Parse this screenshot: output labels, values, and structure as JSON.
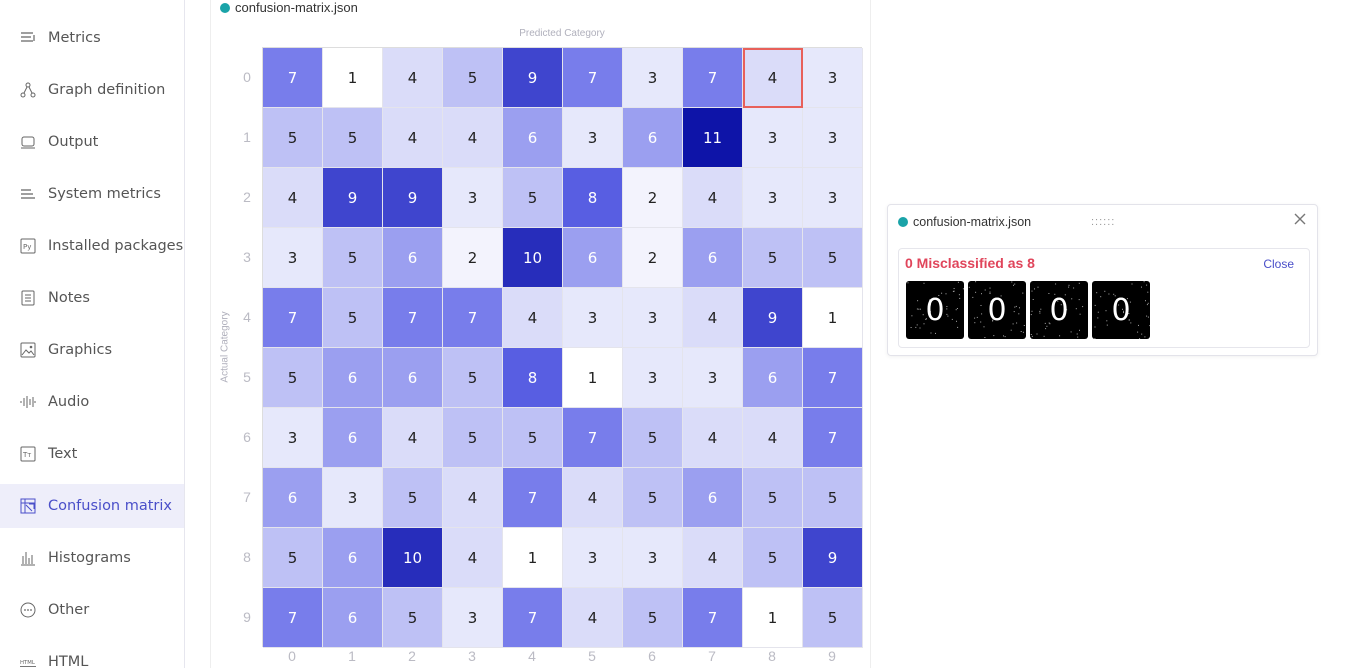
{
  "sidebar": {
    "items": [
      {
        "label": "Metrics",
        "icon": "metrics-icon"
      },
      {
        "label": "Graph definition",
        "icon": "graph-icon"
      },
      {
        "label": "Output",
        "icon": "output-icon"
      },
      {
        "label": "System metrics",
        "icon": "system-metrics-icon"
      },
      {
        "label": "Installed packages",
        "icon": "python-icon"
      },
      {
        "label": "Notes",
        "icon": "notes-icon"
      },
      {
        "label": "Graphics",
        "icon": "image-icon"
      },
      {
        "label": "Audio",
        "icon": "audio-icon"
      },
      {
        "label": "Text",
        "icon": "text-icon"
      },
      {
        "label": "Confusion matrix",
        "icon": "confusion-matrix-icon",
        "active": true
      },
      {
        "label": "Histograms",
        "icon": "histogram-icon"
      },
      {
        "label": "Other",
        "icon": "other-icon"
      },
      {
        "label": "HTML",
        "icon": "html-icon"
      }
    ]
  },
  "main": {
    "file_name": "confusion-matrix.json",
    "predicted_label": "Predicted Category",
    "actual_label": "Actual Category"
  },
  "chart_data": {
    "type": "heatmap",
    "title": "",
    "xlabel": "Predicted Category",
    "ylabel": "Actual Category",
    "x_categories": [
      "0",
      "1",
      "2",
      "3",
      "4",
      "5",
      "6",
      "7",
      "8",
      "9"
    ],
    "y_categories": [
      "0",
      "1",
      "2",
      "3",
      "4",
      "5",
      "6",
      "7",
      "8",
      "9"
    ],
    "values": [
      [
        7,
        1,
        4,
        5,
        9,
        7,
        3,
        7,
        4,
        3
      ],
      [
        5,
        5,
        4,
        4,
        6,
        3,
        6,
        11,
        3,
        3
      ],
      [
        4,
        9,
        9,
        3,
        5,
        8,
        2,
        4,
        3,
        3
      ],
      [
        3,
        5,
        6,
        2,
        10,
        6,
        2,
        6,
        5,
        5
      ],
      [
        7,
        5,
        7,
        7,
        4,
        3,
        3,
        4,
        9,
        1
      ],
      [
        5,
        6,
        6,
        5,
        8,
        1,
        3,
        3,
        6,
        7
      ],
      [
        3,
        6,
        4,
        5,
        5,
        7,
        5,
        4,
        4,
        7
      ],
      [
        6,
        3,
        5,
        4,
        7,
        4,
        5,
        6,
        5,
        5
      ],
      [
        5,
        6,
        10,
        4,
        1,
        3,
        3,
        4,
        5,
        9
      ],
      [
        7,
        6,
        5,
        3,
        7,
        4,
        5,
        7,
        1,
        5
      ]
    ],
    "selected_cell": {
      "row": 0,
      "col": 8
    }
  },
  "popup": {
    "file_name": "confusion-matrix.json",
    "drag_handle": "::::::",
    "title": "0 Misclassified as 8",
    "close_label": "Close",
    "images": [
      "0",
      "0",
      "0",
      "0"
    ]
  }
}
